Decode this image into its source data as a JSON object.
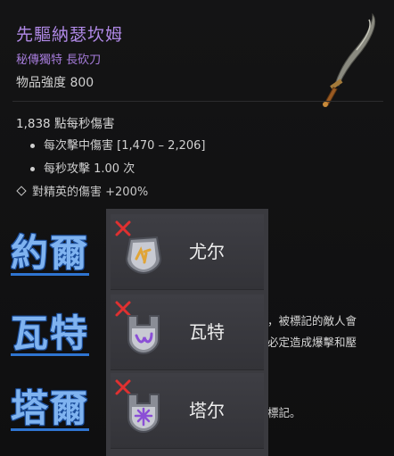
{
  "item": {
    "name": "先驅納瑟坎姆",
    "type": "秘傳獨特 長砍刀",
    "power": "物品強度 800",
    "dps": "1,838 點每秒傷害",
    "stats": [
      "每次擊中傷害 [1,470 – 2,206]",
      "每秒攻擊 1.00 次"
    ],
    "affix": "對精英的傷害 +200%",
    "hidden_text": [
      "，被標記的敵人會",
      "必定造成爆擊和壓",
      "標記。"
    ]
  },
  "overlay_labels": [
    "約爾",
    "瓦特",
    "塔爾"
  ],
  "options": [
    {
      "label": "尤尔",
      "icon": "yul-rune-icon"
    },
    {
      "label": "瓦特",
      "icon": "vex-rune-icon"
    },
    {
      "label": "塔尔",
      "icon": "tal-rune-icon"
    }
  ],
  "colors": {
    "unique_name": "#b089e6",
    "overlay_text": "#7fb3f0",
    "overlay_outline": "#1d4f9c",
    "x_mark": "#e03030"
  }
}
